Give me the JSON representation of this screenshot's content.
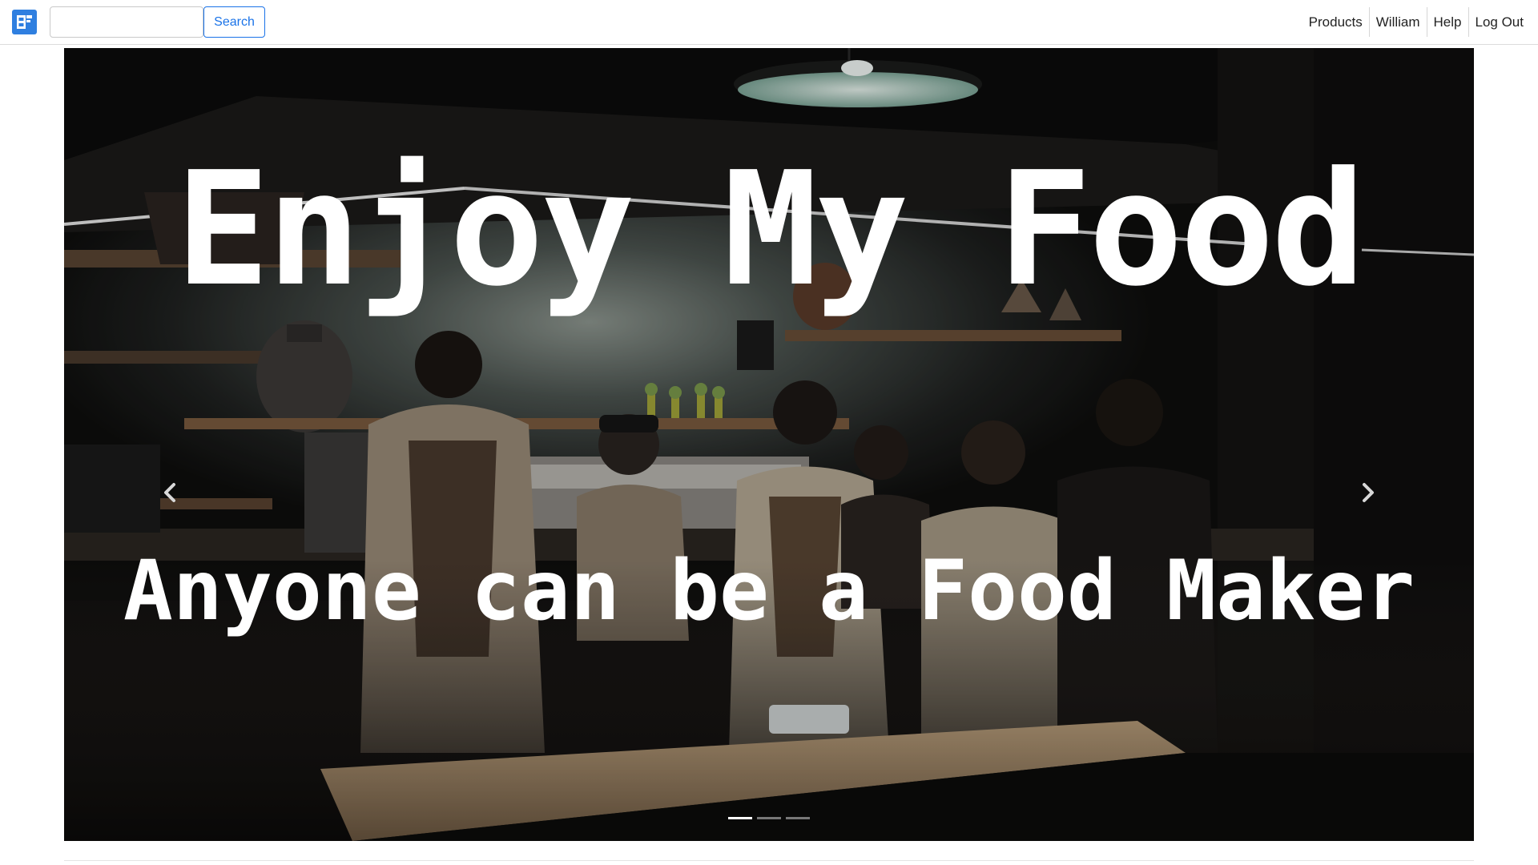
{
  "navbar": {
    "logo_icon": "app-logo-icon",
    "search": {
      "placeholder": "",
      "value": "",
      "button_label": "Search"
    },
    "links": [
      {
        "label": "Products"
      },
      {
        "label": "William"
      },
      {
        "label": "Help"
      },
      {
        "label": "Log Out"
      }
    ]
  },
  "hero": {
    "title": "Enjoy My Food",
    "subtitle": "Anyone can be a Food Maker",
    "background": "dark cafe photo with baristas",
    "prev_icon": "chevron-left-icon",
    "next_icon": "chevron-right-icon",
    "slide_count": 3,
    "active_slide": 1
  },
  "colors": {
    "accent": "#1a73e8",
    "logo": "#2f7fe0",
    "hero_text": "#ffffff"
  }
}
